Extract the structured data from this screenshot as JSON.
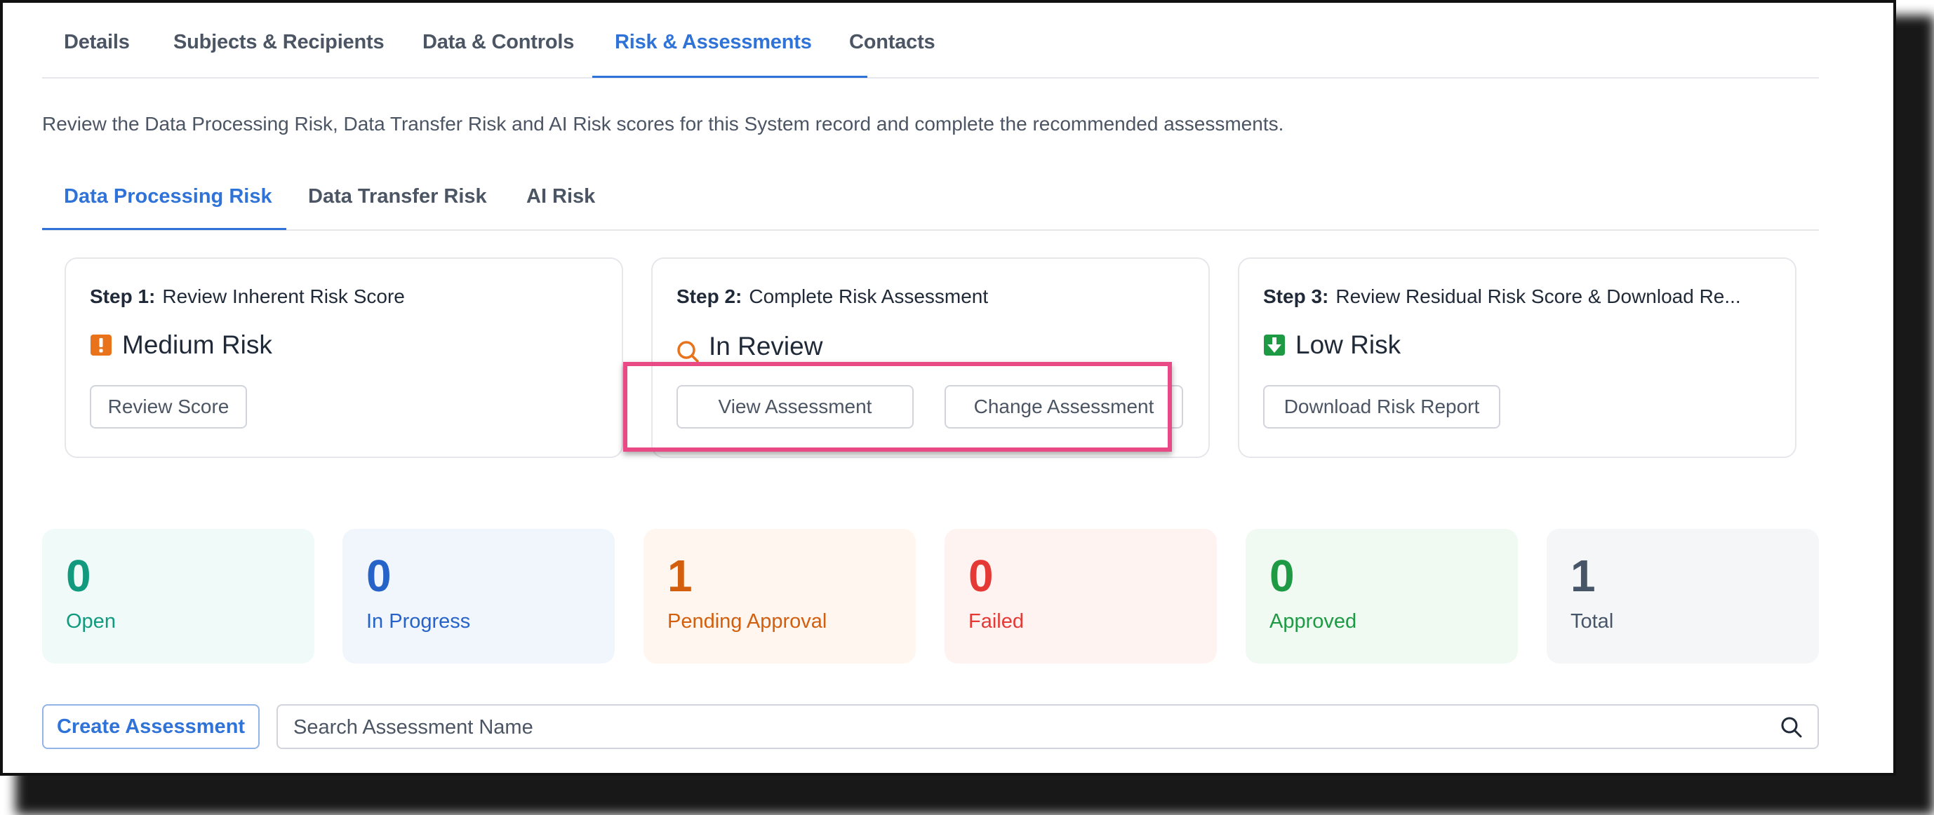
{
  "top_tabs": [
    {
      "label": "Details"
    },
    {
      "label": "Subjects & Recipients"
    },
    {
      "label": "Data & Controls"
    },
    {
      "label": "Risk & Assessments",
      "active": true
    },
    {
      "label": "Contacts"
    }
  ],
  "intro_text": "Review the Data Processing Risk, Data Transfer Risk and AI Risk scores for this System record and complete the recommended assessments.",
  "sub_tabs": [
    {
      "label": "Data Processing Risk",
      "active": true
    },
    {
      "label": "Data Transfer Risk"
    },
    {
      "label": "AI Risk"
    }
  ],
  "steps": [
    {
      "step_label": "Step 1:",
      "title": "Review Inherent Risk Score",
      "status": "Medium Risk",
      "status_icon": "exclamation-square-icon",
      "status_color": "#e8731a",
      "buttons": [
        "Review Score"
      ]
    },
    {
      "step_label": "Step 2:",
      "title": "Complete Risk Assessment",
      "status": "In Review",
      "status_icon": "magnifier-icon",
      "status_color": "#e8731a",
      "buttons": [
        "View Assessment",
        "Change Assessment"
      ]
    },
    {
      "step_label": "Step 3:",
      "title": "Review Residual Risk Score & Download Re...",
      "status": "Low Risk",
      "status_icon": "arrow-down-square-icon",
      "status_color": "#1e9a45",
      "buttons": [
        "Download Risk Report"
      ]
    }
  ],
  "stats": [
    {
      "value": "0",
      "label": "Open",
      "color": "#129a7f",
      "bg": "#f0faf8"
    },
    {
      "value": "0",
      "label": "In Progress",
      "color": "#2563c9",
      "bg": "#f1f6fd"
    },
    {
      "value": "1",
      "label": "Pending Approval",
      "color": "#d35f0e",
      "bg": "#fff6ef"
    },
    {
      "value": "0",
      "label": "Failed",
      "color": "#e53935",
      "bg": "#fff3f2"
    },
    {
      "value": "0",
      "label": "Approved",
      "color": "#1e9a45",
      "bg": "#f0faf3"
    },
    {
      "value": "1",
      "label": "Total",
      "color": "#475569",
      "bg": "#f5f6f8"
    }
  ],
  "create_button": "Create Assessment",
  "search": {
    "placeholder": "Search Assessment Name",
    "value": ""
  },
  "colors": {
    "accent": "#2f73d9",
    "highlight": "#e94a86"
  }
}
